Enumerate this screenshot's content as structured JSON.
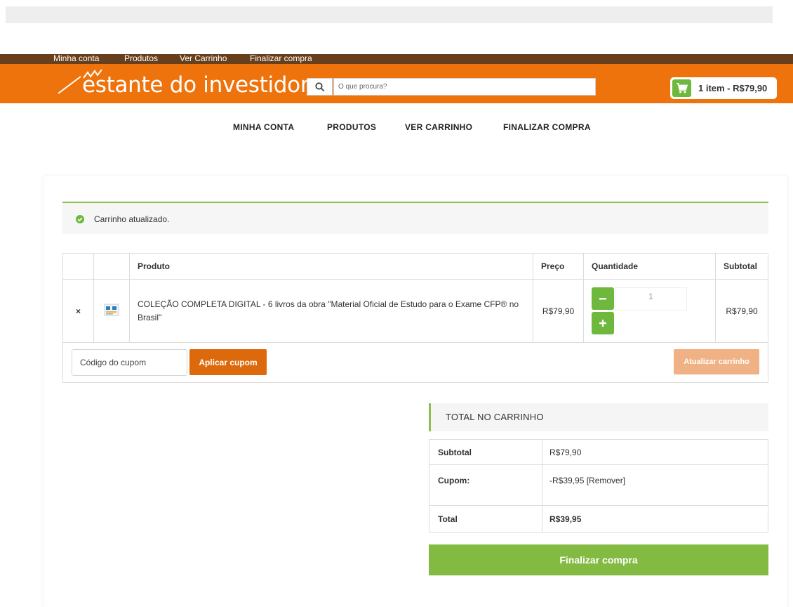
{
  "topbar": {
    "links": [
      "Minha conta",
      "Produtos",
      "Ver Carrinho",
      "Finalizar compra"
    ]
  },
  "header": {
    "logo_text": "estante do investidor",
    "search_placeholder": "O que procura?",
    "cart_summary": "1 item - R$79,90",
    "brand_color": "#ee730d",
    "topbar_color": "#673f1c",
    "accent_green": "#6eb83d"
  },
  "mainnav": {
    "links": [
      "MINHA CONTA",
      "PRODUTOS",
      "VER CARRINHO",
      "FINALIZAR COMPRA"
    ]
  },
  "notice": {
    "text": "Carrinho atualizado.",
    "icon": "check-circle-icon"
  },
  "cart_table": {
    "headers": {
      "product": "Produto",
      "price": "Preço",
      "quantity": "Quantidade",
      "subtotal": "Subtotal"
    },
    "rows": [
      {
        "remove": "×",
        "thumbnail_icon": "product-thumbnail-icon",
        "product": "COLEÇÃO COMPLETA DIGITAL - 6 livros da obra \"Material Oficial de Estudo para o Exame CFP® no Brasil\"",
        "price": "R$79,90",
        "quantity": "1",
        "subtotal": "R$79,90"
      }
    ]
  },
  "coupon": {
    "placeholder": "Código do cupom",
    "apply_label": "Aplicar cupom",
    "update_label": "Atualizar carrinho"
  },
  "totals": {
    "title": "TOTAL NO CARRINHO",
    "subtotal_label": "Subtotal",
    "subtotal_value": "R$79,90",
    "coupon_label": "Cupom:",
    "coupon_value": "-R$39,95 [Remover]",
    "total_label": "Total",
    "total_value": "R$39,95",
    "checkout_label": "Finalizar compra"
  }
}
